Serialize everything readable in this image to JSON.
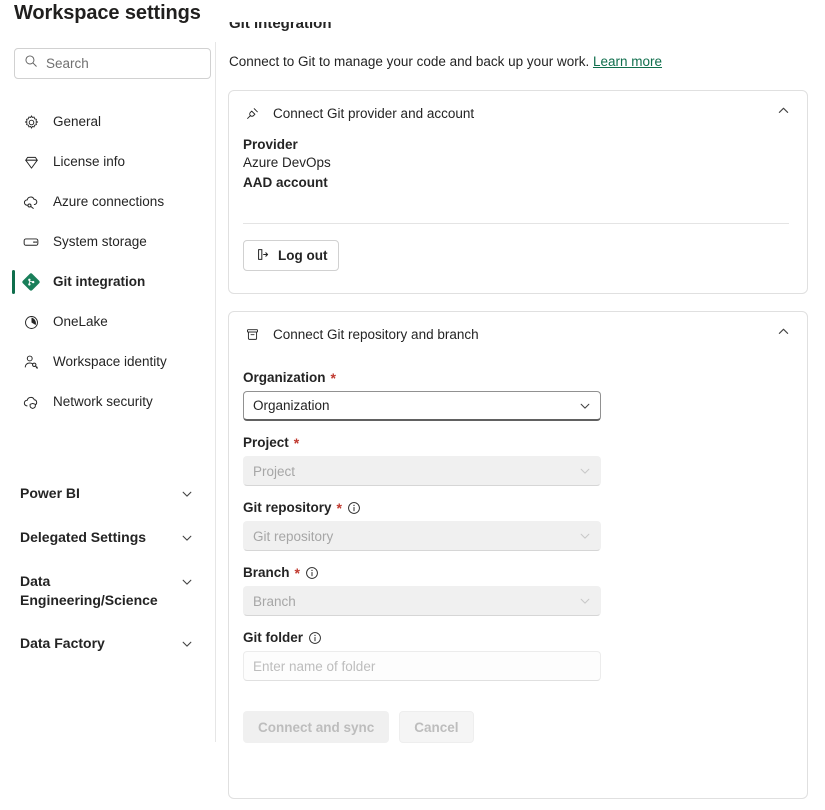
{
  "page_title": "Workspace settings",
  "search": {
    "placeholder": "Search",
    "value": "",
    "icon": "search-icon"
  },
  "sidebar": {
    "items": [
      {
        "label": "General",
        "icon": "gear-icon",
        "selected": false
      },
      {
        "label": "License info",
        "icon": "diamond-icon",
        "selected": false
      },
      {
        "label": "Azure connections",
        "icon": "cloud-link-icon",
        "selected": false
      },
      {
        "label": "System storage",
        "icon": "storage-icon",
        "selected": false
      },
      {
        "label": "Git integration",
        "icon": "git-icon",
        "selected": true
      },
      {
        "label": "OneLake",
        "icon": "onelake-icon",
        "selected": false
      },
      {
        "label": "Workspace identity",
        "icon": "person-key-icon",
        "selected": false
      },
      {
        "label": "Network security",
        "icon": "cloud-shield-icon",
        "selected": false
      }
    ],
    "groups": [
      {
        "label": "Power BI",
        "icon": "chevron-down-icon"
      },
      {
        "label": "Delegated Settings",
        "icon": "chevron-down-icon"
      },
      {
        "label": "Data Engineering/Science",
        "icon": "chevron-down-icon"
      },
      {
        "label": "Data Factory",
        "icon": "chevron-down-icon"
      }
    ]
  },
  "content": {
    "clipped_heading": "Git integration",
    "description": "Connect to Git to manage your code and back up your work.",
    "learn_more": "Learn more",
    "provider_card": {
      "title": "Connect Git provider and account",
      "icon": "plug-icon",
      "collapse_icon": "chevron-up-icon",
      "provider_label": "Provider",
      "provider_value": "Azure DevOps",
      "account_label": "AAD account",
      "account_value": "",
      "logout_label": "Log out",
      "logout_icon": "sign-out-icon"
    },
    "repo_card": {
      "title": "Connect Git repository and branch",
      "icon": "repo-box-icon",
      "collapse_icon": "chevron-up-icon",
      "fields": [
        {
          "label": "Organization",
          "required": "*",
          "value": "Organization",
          "placeholder": "Organization",
          "disabled": false,
          "has_info": false,
          "control": "select"
        },
        {
          "label": "Project",
          "required": "*",
          "value": "",
          "placeholder": "Project",
          "disabled": true,
          "has_info": false,
          "control": "select"
        },
        {
          "label": "Git repository",
          "required": "*",
          "value": "",
          "placeholder": "Git repository",
          "disabled": true,
          "has_info": true,
          "control": "select"
        },
        {
          "label": "Branch",
          "required": "*",
          "value": "",
          "placeholder": "Branch",
          "disabled": true,
          "has_info": true,
          "control": "select"
        },
        {
          "label": "Git folder",
          "required": "",
          "value": "",
          "placeholder": "Enter name of folder",
          "disabled": false,
          "has_info": true,
          "control": "text"
        }
      ],
      "primary_button": "Connect and sync",
      "secondary_button": "Cancel"
    }
  },
  "colors": {
    "accent_green": "#0f6e4c",
    "required_red": "#c0392f",
    "text": "#242424",
    "disabled_text": "#bdbdbd",
    "border": "#e0e0e0"
  }
}
